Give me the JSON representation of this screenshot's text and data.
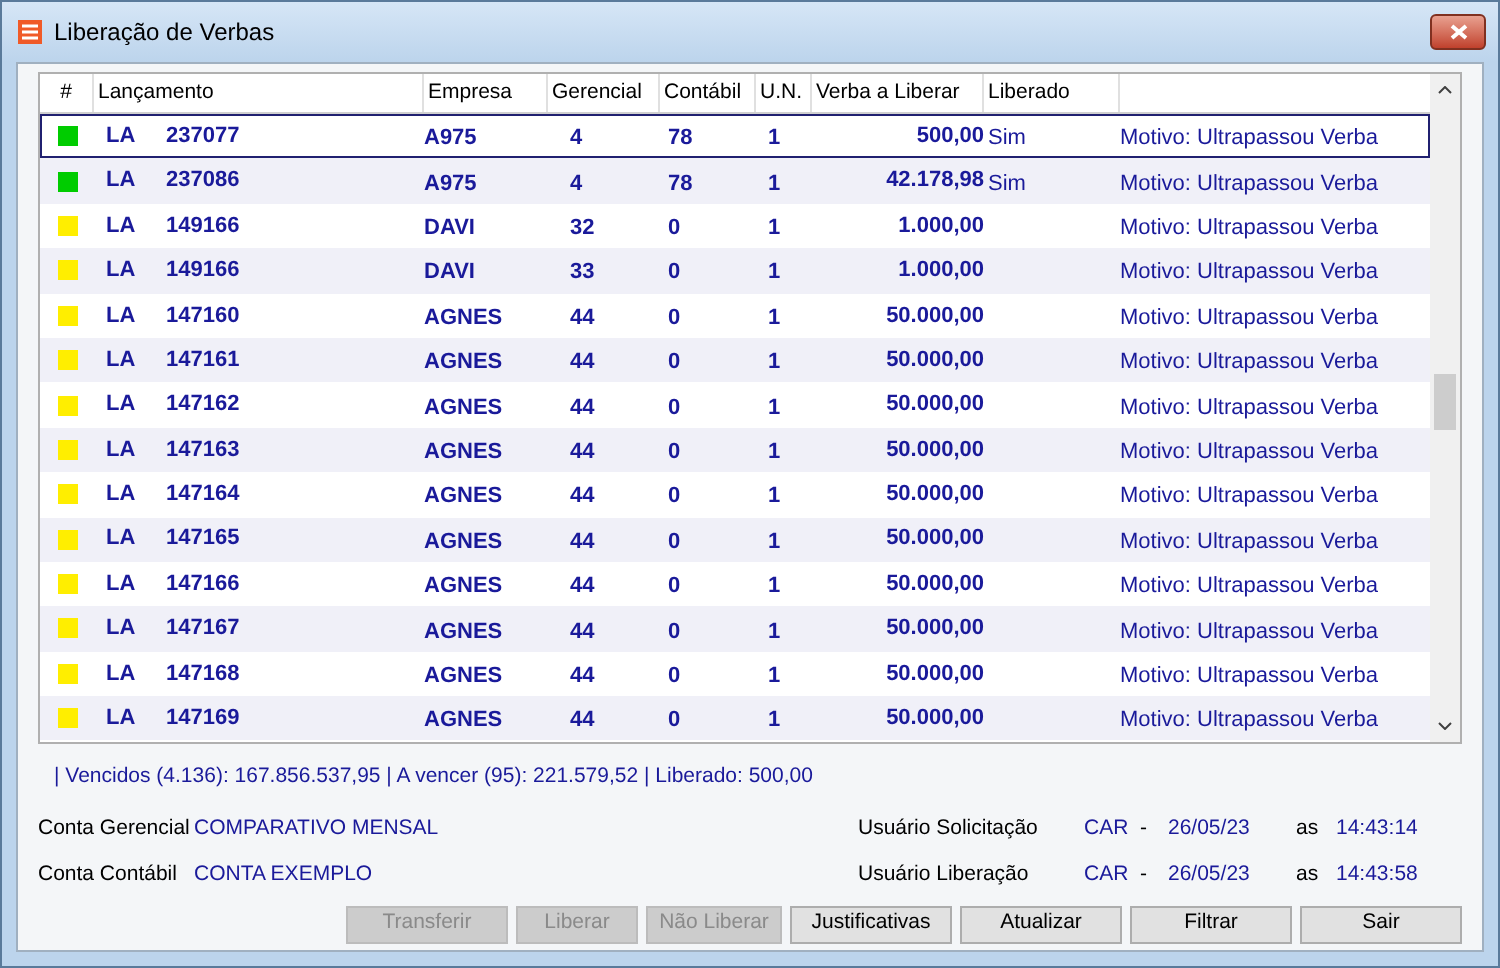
{
  "window": {
    "title": "Liberação de Verbas"
  },
  "table": {
    "columns": [
      "#",
      "Lançamento",
      "Empresa",
      "Gerencial",
      "Contábil",
      "U.N.",
      "Verba a Liberar",
      "Liberado"
    ],
    "rows": [
      {
        "selected": true,
        "color": "#00cc00",
        "tipo": "LA",
        "lancamento": "237077",
        "empresa": "A975",
        "gerencial": "4",
        "contabil": "78",
        "un": "1",
        "verba": "500,00",
        "liberado": "Sim",
        "motivo": "Motivo: Ultrapassou Verba"
      },
      {
        "selected": false,
        "color": "#00cc00",
        "tipo": "LA",
        "lancamento": "237086",
        "empresa": "A975",
        "gerencial": "4",
        "contabil": "78",
        "un": "1",
        "verba": "42.178,98",
        "liberado": "Sim",
        "motivo": "Motivo: Ultrapassou Verba"
      },
      {
        "selected": false,
        "color": "#ffee00",
        "tipo": "LA",
        "lancamento": "149166",
        "empresa": "DAVI",
        "gerencial": "32",
        "contabil": "0",
        "un": "1",
        "verba": "1.000,00",
        "motivo": "Motivo: Ultrapassou Verba"
      },
      {
        "selected": false,
        "color": "#ffee00",
        "tipo": "LA",
        "lancamento": "149166",
        "empresa": "DAVI",
        "gerencial": "33",
        "contabil": "0",
        "un": "1",
        "verba": "1.000,00",
        "motivo": "Motivo: Ultrapassou Verba"
      },
      {
        "selected": false,
        "color": "#ffee00",
        "tipo": "LA",
        "lancamento": "147160",
        "empresa": "AGNES",
        "gerencial": "44",
        "contabil": "0",
        "un": "1",
        "verba": "50.000,00",
        "motivo": "Motivo: Ultrapassou Verba"
      },
      {
        "selected": false,
        "color": "#ffee00",
        "tipo": "LA",
        "lancamento": "147161",
        "empresa": "AGNES",
        "gerencial": "44",
        "contabil": "0",
        "un": "1",
        "verba": "50.000,00",
        "motivo": "Motivo: Ultrapassou Verba"
      },
      {
        "selected": false,
        "color": "#ffee00",
        "tipo": "LA",
        "lancamento": "147162",
        "empresa": "AGNES",
        "gerencial": "44",
        "contabil": "0",
        "un": "1",
        "verba": "50.000,00",
        "motivo": "Motivo: Ultrapassou Verba"
      },
      {
        "selected": false,
        "color": "#ffee00",
        "tipo": "LA",
        "lancamento": "147163",
        "empresa": "AGNES",
        "gerencial": "44",
        "contabil": "0",
        "un": "1",
        "verba": "50.000,00",
        "motivo": "Motivo: Ultrapassou Verba"
      },
      {
        "selected": false,
        "color": "#ffee00",
        "tipo": "LA",
        "lancamento": "147164",
        "empresa": "AGNES",
        "gerencial": "44",
        "contabil": "0",
        "un": "1",
        "verba": "50.000,00",
        "motivo": "Motivo: Ultrapassou Verba"
      },
      {
        "selected": false,
        "color": "#ffee00",
        "tipo": "LA",
        "lancamento": "147165",
        "empresa": "AGNES",
        "gerencial": "44",
        "contabil": "0",
        "un": "1",
        "verba": "50.000,00",
        "motivo": "Motivo: Ultrapassou Verba"
      },
      {
        "selected": false,
        "color": "#ffee00",
        "tipo": "LA",
        "lancamento": "147166",
        "empresa": "AGNES",
        "gerencial": "44",
        "contabil": "0",
        "un": "1",
        "verba": "50.000,00",
        "motivo": "Motivo: Ultrapassou Verba"
      },
      {
        "selected": false,
        "color": "#ffee00",
        "tipo": "LA",
        "lancamento": "147167",
        "empresa": "AGNES",
        "gerencial": "44",
        "contabil": "0",
        "un": "1",
        "verba": "50.000,00",
        "motivo": "Motivo: Ultrapassou Verba"
      },
      {
        "selected": false,
        "color": "#ffee00",
        "tipo": "LA",
        "lancamento": "147168",
        "empresa": "AGNES",
        "gerencial": "44",
        "contabil": "0",
        "un": "1",
        "verba": "50.000,00",
        "motivo": "Motivo: Ultrapassou Verba"
      },
      {
        "selected": false,
        "color": "#ffee00",
        "tipo": "LA",
        "lancamento": "147169",
        "empresa": "AGNES",
        "gerencial": "44",
        "contabil": "0",
        "un": "1",
        "verba": "50.000,00",
        "motivo": "Motivo: Ultrapassou Verba"
      }
    ]
  },
  "summary": "| Vencidos (4.136): 167.856.537,95 | A vencer (95): 221.579,52 | Liberado: 500,00",
  "accounts": [
    {
      "label": "Conta Gerencial",
      "value": "COMPARATIVO MENSAL"
    },
    {
      "label": "Conta Contábil",
      "value": "CONTA EXEMPLO"
    }
  ],
  "users": [
    {
      "label": "Usuário Solicitação",
      "user": "CAR",
      "dash": "-",
      "date": "26/05/23",
      "as": "as",
      "time": "14:43:14"
    },
    {
      "label": "Usuário Liberação",
      "user": "CAR",
      "dash": "-",
      "date": "26/05/23",
      "as": "as",
      "time": "14:43:58"
    }
  ],
  "buttons": [
    {
      "label": "Transferir",
      "disabled": true
    },
    {
      "label": "Liberar",
      "disabled": true
    },
    {
      "label": "Não Liberar",
      "disabled": true
    },
    {
      "label": "Justificativas",
      "disabled": false
    },
    {
      "label": "Atualizar",
      "disabled": false
    },
    {
      "label": "Filtrar",
      "disabled": false
    },
    {
      "label": "Sair",
      "disabled": false
    }
  ]
}
